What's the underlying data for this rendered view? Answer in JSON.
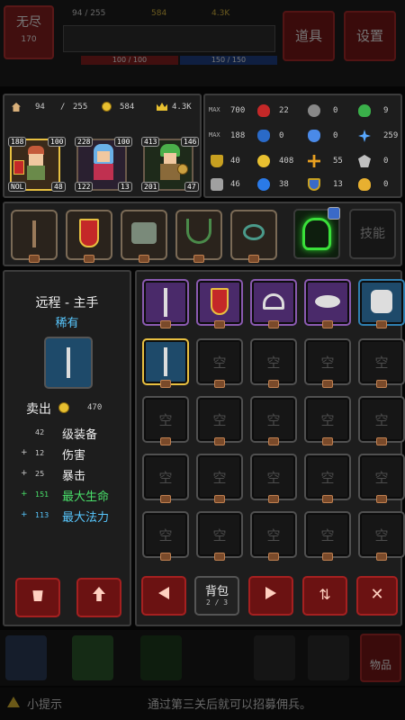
{
  "top_bar": {
    "badge": "无尽",
    "badge_sub": "170",
    "res1": "94 / 255",
    "res2": "584",
    "res3": "4.3K",
    "bar1": "100 / 100",
    "bar2": "150 / 150",
    "props_btn": "道具",
    "settings_btn": "设置"
  },
  "resources": {
    "pop": "94",
    "pop_max": "255",
    "gold": "584",
    "crown": "4.3K"
  },
  "heroes": [
    {
      "level_tl": "188",
      "level_tr": "100",
      "level_bl": "NOL",
      "level_br": "48"
    },
    {
      "level_tl": "228",
      "level_tr": "100",
      "level_bl": "122",
      "level_br": "13"
    },
    {
      "level_tl": "413",
      "level_tr": "146",
      "level_bl": "201",
      "level_br": "47"
    }
  ],
  "stats": {
    "r1": [
      "700",
      "22",
      "0",
      "9"
    ],
    "r2": [
      "188",
      "0",
      "0",
      "259"
    ],
    "r3": [
      "40",
      "408",
      "55",
      "0"
    ],
    "r4": [
      "46",
      "38",
      "13",
      "0"
    ],
    "max1": "MAX",
    "max2": "MAX"
  },
  "skill_button": "技能",
  "item_detail": {
    "title": "远程 - 主手",
    "rarity": "稀有",
    "sell_label": "卖出",
    "sell_price": "470",
    "level_num": "42",
    "level_label": "级装备",
    "lines": [
      {
        "value": "12",
        "label": "伤害"
      },
      {
        "value": "25",
        "label": "暴击"
      },
      {
        "value": "151",
        "label": "最大生命"
      },
      {
        "value": "113",
        "label": "最大法力"
      }
    ],
    "bonus_sign": "+"
  },
  "inventory": {
    "empty_label": "空",
    "bag_label": "背包",
    "page": "2 / 3"
  },
  "bottom": {
    "items_label": "物品",
    "tip_label": "小提示",
    "tip_text": "通过第三关后就可以招募佣兵。"
  },
  "colors": {
    "rare_blue": "#2f7fb0",
    "purple": "#7a3fa0",
    "red": "#a52020",
    "green_text": "#49e06a",
    "blue_text": "#58c8ff"
  }
}
